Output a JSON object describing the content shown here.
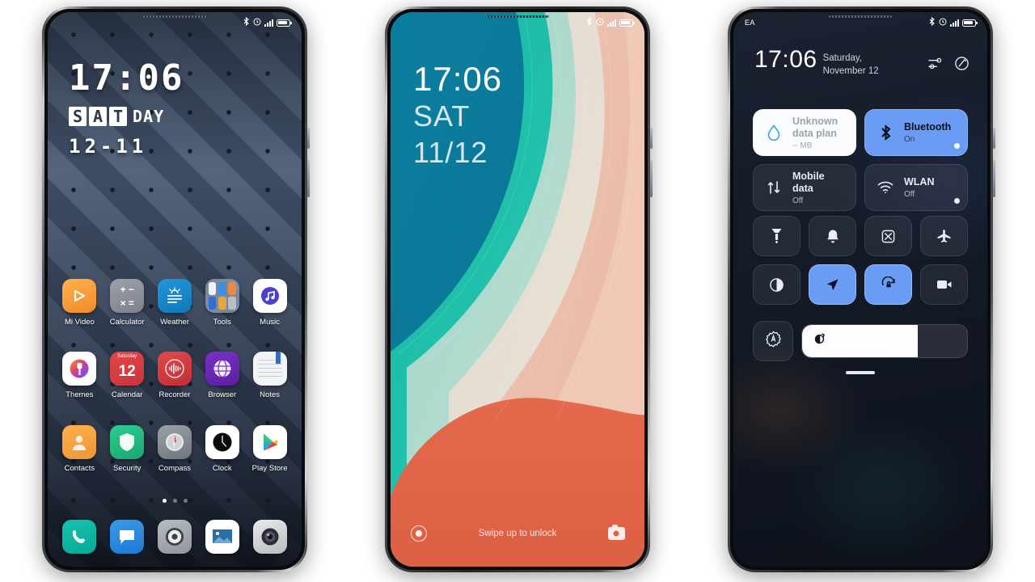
{
  "scene": {
    "background": "#ffffff",
    "device_count": 3
  },
  "phone1": {
    "name": "home-screen",
    "statusbar": {
      "carrier": "",
      "icons": [
        "bluetooth-icon",
        "alarm-icon",
        "signal-icon",
        "battery-icon"
      ]
    },
    "widget": {
      "time": "17:06",
      "day_chips": [
        "S",
        "A",
        "T"
      ],
      "day_rest": "DAY",
      "date": "12-11"
    },
    "apps_rows": [
      [
        {
          "label": "Mi Video",
          "icon": "mi-video-icon"
        },
        {
          "label": "Calculator",
          "icon": "calculator-icon"
        },
        {
          "label": "Weather",
          "icon": "weather-icon"
        },
        {
          "label": "Tools",
          "icon": "tools-folder-icon"
        },
        {
          "label": "Music",
          "icon": "music-icon"
        }
      ],
      [
        {
          "label": "Themes",
          "icon": "themes-icon"
        },
        {
          "label": "Calendar",
          "icon": "calendar-icon",
          "weekday": "Saturday",
          "day": "12"
        },
        {
          "label": "Recorder",
          "icon": "recorder-icon"
        },
        {
          "label": "Browser",
          "icon": "browser-icon"
        },
        {
          "label": "Notes",
          "icon": "notes-icon"
        }
      ],
      [
        {
          "label": "Contacts",
          "icon": "contacts-icon"
        },
        {
          "label": "Security",
          "icon": "security-icon"
        },
        {
          "label": "Compass",
          "icon": "compass-icon"
        },
        {
          "label": "Clock",
          "icon": "clock-icon"
        },
        {
          "label": "Play Store",
          "icon": "play-store-icon"
        }
      ]
    ],
    "page_dots": {
      "count": 3,
      "active": 0
    },
    "dock": [
      {
        "label": "Phone",
        "icon": "phone-icon"
      },
      {
        "label": "Messages",
        "icon": "messages-icon"
      },
      {
        "label": "Settings",
        "icon": "settings-icon"
      },
      {
        "label": "Gallery",
        "icon": "gallery-icon"
      },
      {
        "label": "Camera",
        "icon": "camera-icon"
      }
    ]
  },
  "phone2": {
    "name": "lock-screen",
    "statusbar": {
      "icons": [
        "bluetooth-icon",
        "alarm-icon",
        "signal-icon",
        "battery-icon"
      ]
    },
    "clock": {
      "time": "17:06",
      "weekday": "SAT",
      "date": "11/12"
    },
    "bottom": {
      "left_icon": "flashlight-ring-icon",
      "hint": "Swipe up to unlock",
      "right_icon": "camera-icon"
    },
    "wallpaper_colors": [
      "#0b7fa0",
      "#1fb9a6",
      "#a8d8cc",
      "#e6ddd2",
      "#e8a893",
      "#e2654a"
    ]
  },
  "phone3": {
    "name": "control-center",
    "statusbar": {
      "carrier": "EA",
      "icons": [
        "bluetooth-icon",
        "alarm-icon",
        "signal-icon",
        "battery-icon"
      ]
    },
    "header": {
      "time": "17:06",
      "date": "Saturday, November 12",
      "actions": [
        "settings-sliders-icon",
        "edit-icon"
      ]
    },
    "tiles": [
      {
        "title": "Unknown data plan",
        "subtitle": "-- MB",
        "icon": "data-drop-icon",
        "state": "light",
        "dot": false
      },
      {
        "title": "Bluetooth",
        "subtitle": "On",
        "icon": "bluetooth-icon",
        "state": "blue",
        "dot": true
      },
      {
        "title": "Mobile data",
        "subtitle": "Off",
        "icon": "mobile-data-icon",
        "state": "dark",
        "dot": false
      },
      {
        "title": "WLAN",
        "subtitle": "Off",
        "icon": "wlan-icon",
        "state": "dark",
        "dot": true
      }
    ],
    "toggles": [
      {
        "name": "flashlight-icon",
        "active": false
      },
      {
        "name": "bell-icon",
        "active": false
      },
      {
        "name": "screenshot-icon",
        "active": false
      },
      {
        "name": "airplane-icon",
        "active": false
      },
      {
        "name": "dark-mode-icon",
        "active": false
      },
      {
        "name": "location-icon",
        "active": true
      },
      {
        "name": "rotation-lock-icon",
        "active": true
      },
      {
        "name": "screen-record-icon",
        "active": false
      }
    ],
    "brightness": {
      "auto_icon": "auto-brightness-icon",
      "slider_icon": "brightness-icon",
      "level_percent": 70
    },
    "accent_color": "#6b9cf5"
  }
}
